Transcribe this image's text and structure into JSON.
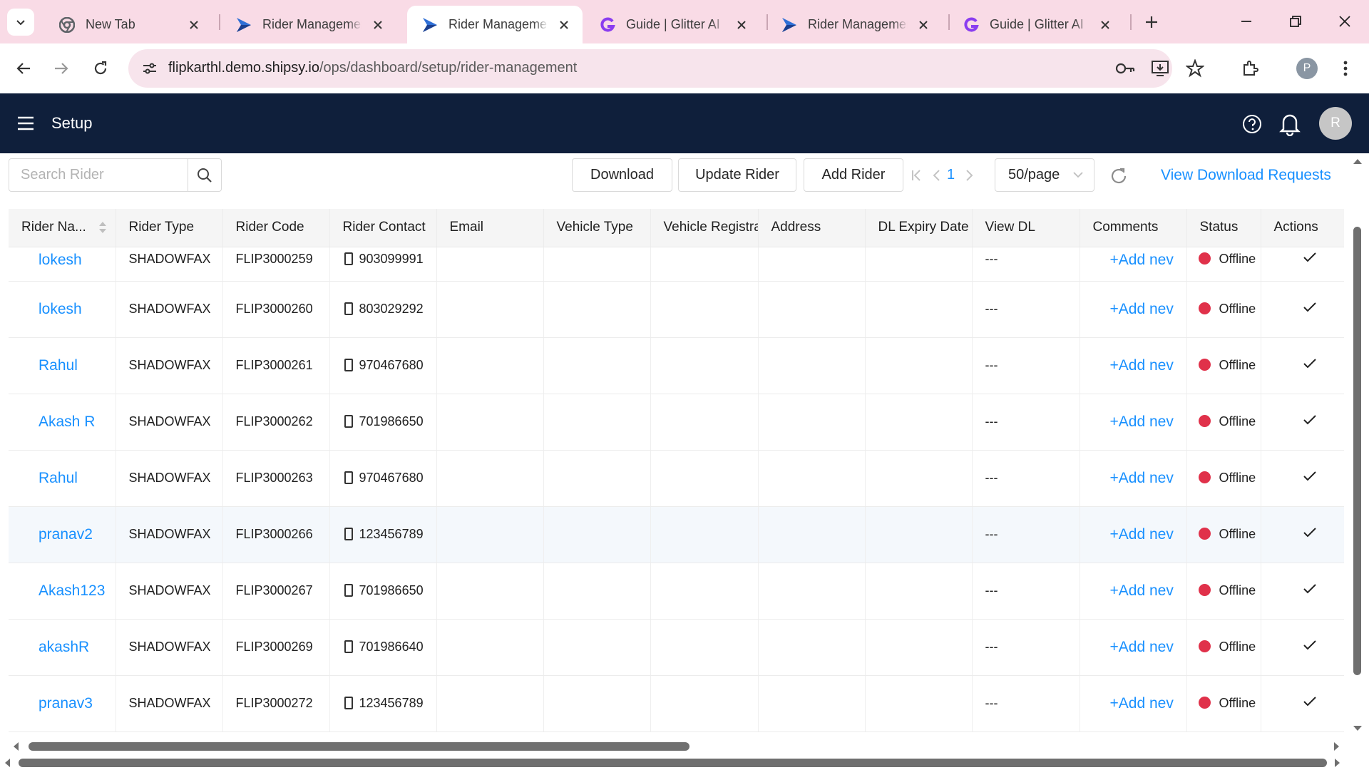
{
  "browser": {
    "tabs": [
      {
        "title": "New Tab",
        "favicon": "chrome-icon",
        "active": false
      },
      {
        "title": "Rider Management",
        "favicon": "shipsy-icon",
        "active": false
      },
      {
        "title": "Rider Management",
        "favicon": "shipsy-icon",
        "active": true
      },
      {
        "title": "Guide | Glitter AI",
        "favicon": "glitter-icon",
        "active": false
      },
      {
        "title": "Rider Management",
        "favicon": "shipsy-icon",
        "active": false
      },
      {
        "title": "Guide | Glitter AI",
        "favicon": "glitter-icon",
        "active": false
      }
    ],
    "url_host": "flipkarthl.demo.shipsy.io",
    "url_path": "/ops/dashboard/setup/rider-management",
    "profile_initial": "P",
    "accent_color": "#f9dbe6"
  },
  "app": {
    "title": "Setup",
    "user_initial": "R",
    "header_color": "#0f1f3b"
  },
  "controls": {
    "search_placeholder": "Search Rider",
    "download_label": "Download",
    "update_label": "Update Rider",
    "add_label": "Add Rider",
    "current_page": "1",
    "page_size": "50/page",
    "view_requests_label": "View Download Requests",
    "link_color": "#1890ff"
  },
  "table": {
    "columns": [
      "Rider Na...",
      "Rider Type",
      "Rider Code",
      "Rider Contact",
      "Email",
      "Vehicle Type",
      "Vehicle Registrat",
      "Address",
      "DL Expiry Date",
      "View DL",
      "Comments",
      "Status",
      "Actions"
    ],
    "rows": [
      {
        "name": "lokesh",
        "type": "SHADOWFAX",
        "code": "FLIP3000259",
        "contact": "903099991",
        "email": "",
        "vehicle_type": "",
        "vehicle_reg": "",
        "address": "",
        "dl_expiry": "",
        "view_dl": "---",
        "comment": "+Add nev",
        "status": "Offline"
      },
      {
        "name": "lokesh",
        "type": "SHADOWFAX",
        "code": "FLIP3000260",
        "contact": "803029292",
        "email": "",
        "vehicle_type": "",
        "vehicle_reg": "",
        "address": "",
        "dl_expiry": "",
        "view_dl": "---",
        "comment": "+Add nev",
        "status": "Offline"
      },
      {
        "name": "Rahul",
        "type": "SHADOWFAX",
        "code": "FLIP3000261",
        "contact": "970467680",
        "email": "",
        "vehicle_type": "",
        "vehicle_reg": "",
        "address": "",
        "dl_expiry": "",
        "view_dl": "---",
        "comment": "+Add nev",
        "status": "Offline"
      },
      {
        "name": "Akash R",
        "type": "SHADOWFAX",
        "code": "FLIP3000262",
        "contact": "701986650",
        "email": "",
        "vehicle_type": "",
        "vehicle_reg": "",
        "address": "",
        "dl_expiry": "",
        "view_dl": "---",
        "comment": "+Add nev",
        "status": "Offline"
      },
      {
        "name": "Rahul",
        "type": "SHADOWFAX",
        "code": "FLIP3000263",
        "contact": "970467680",
        "email": "",
        "vehicle_type": "",
        "vehicle_reg": "",
        "address": "",
        "dl_expiry": "",
        "view_dl": "---",
        "comment": "+Add nev",
        "status": "Offline"
      },
      {
        "name": "pranav2",
        "type": "SHADOWFAX",
        "code": "FLIP3000266",
        "contact": "123456789",
        "email": "",
        "vehicle_type": "",
        "vehicle_reg": "",
        "address": "",
        "dl_expiry": "",
        "view_dl": "---",
        "comment": "+Add nev",
        "status": "Offline"
      },
      {
        "name": "Akash123",
        "type": "SHADOWFAX",
        "code": "FLIP3000267",
        "contact": "701986650",
        "email": "",
        "vehicle_type": "",
        "vehicle_reg": "",
        "address": "",
        "dl_expiry": "",
        "view_dl": "---",
        "comment": "+Add nev",
        "status": "Offline"
      },
      {
        "name": "akashR",
        "type": "SHADOWFAX",
        "code": "FLIP3000269",
        "contact": "701986640",
        "email": "",
        "vehicle_type": "",
        "vehicle_reg": "",
        "address": "",
        "dl_expiry": "",
        "view_dl": "---",
        "comment": "+Add nev",
        "status": "Offline"
      },
      {
        "name": "pranav3",
        "type": "SHADOWFAX",
        "code": "FLIP3000272",
        "contact": "123456789",
        "email": "",
        "vehicle_type": "",
        "vehicle_reg": "",
        "address": "",
        "dl_expiry": "",
        "view_dl": "---",
        "comment": "+Add nev",
        "status": "Offline"
      }
    ],
    "status_color": "#e0314a",
    "action_icon": "check-icon"
  }
}
